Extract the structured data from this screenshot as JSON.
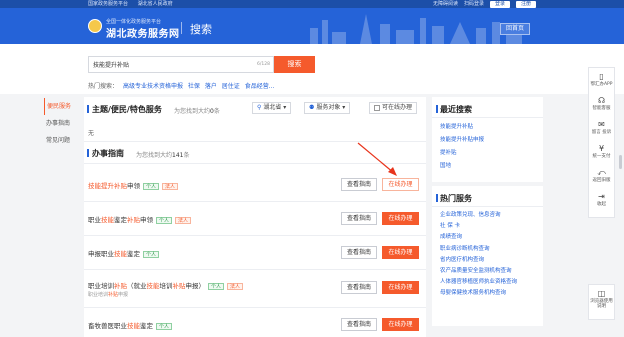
{
  "topbar": {
    "left": [
      "国家政务服务平台",
      "湖北省人民政府"
    ],
    "accessibility": "无障碍阅读",
    "scan": "扫码登录",
    "login": "登录",
    "register": "注册"
  },
  "header": {
    "logo_sub": "全国一体化政务服务平台",
    "logo_main": "湖北政务服务网",
    "page_title": "搜索",
    "home_button": "回首页"
  },
  "search": {
    "value": "技能提升补贴",
    "counter": "6/128",
    "button": "搜索",
    "hot_label": "热门搜索：",
    "hot_items": [
      "高级专业技术资格申报",
      "社保",
      "落户",
      "居住证",
      "食品经营..."
    ]
  },
  "left_nav": [
    "便民服务",
    "办事指南",
    "常见问题"
  ],
  "sections": {
    "themes": {
      "title": "主题/便民/特色服务",
      "count_prefix": "为您找到大约",
      "count": "0",
      "count_suffix": "条",
      "region": "湖北省",
      "target": "服务对象",
      "online_only": "可在线办理",
      "empty_text": "无"
    },
    "guides": {
      "title": "办事指南",
      "count_prefix": "为您找到大约",
      "count": "141",
      "count_suffix": "条"
    }
  },
  "results": [
    {
      "pre": "",
      "hl": "技能提升补贴",
      "post": "申领",
      "tags": [
        "个人",
        "法人"
      ],
      "sub_pre": "",
      "sub_hl": "",
      "view": "查看指南",
      "online": "在线办理"
    },
    {
      "pre": "职业",
      "hl": "技能",
      "mid": "鉴定",
      "hl2": "补贴",
      "post": "申领",
      "tags": [
        "个人",
        "法人"
      ],
      "view": "查看指南",
      "online": "在线办理"
    },
    {
      "pre": "申报职业",
      "hl": "技能",
      "post": "鉴定",
      "tags": [
        "个人"
      ],
      "view": "查看指南",
      "online": "在线办理"
    },
    {
      "pre": "职业培训",
      "hl": "补贴",
      "mid": "（就业",
      "hl2": "技能",
      "mid2": "培训",
      "hl3": "补贴",
      "post": "申报）",
      "tags": [
        "个人",
        "法人"
      ],
      "sub_pre": "职业培训",
      "sub_hl": "补贴",
      "sub_post": "申报",
      "view": "查看指南",
      "online": "在线办理"
    },
    {
      "pre": "畜牧兽医职业",
      "hl": "技能",
      "post": "鉴定",
      "tags": [
        "个人"
      ],
      "view": "查看指南",
      "online": "在线办理"
    }
  ],
  "recent": {
    "title": "最近搜索",
    "items": [
      "技能提升补贴",
      "技能提升补贴申报",
      "提补贴",
      "国地"
    ]
  },
  "hot_services": {
    "title": "热门服务",
    "items": [
      "企业政策兑现、信息咨询",
      "社 保 卡",
      "成绩查询",
      "职业病诊断机构查询",
      "省内医疗机构查询",
      "农产品质量安全监测机构查询",
      "人体器官移植医师执业资格查询",
      "母婴保健技术服务机构查询"
    ]
  },
  "float_toolbar": [
    {
      "icon": "phone-icon",
      "label": "鄂汇办APP",
      "glyph": "▯"
    },
    {
      "icon": "headset-icon",
      "label": "智能客服",
      "glyph": "☊"
    },
    {
      "icon": "mail-icon",
      "label": "留言 投诉",
      "glyph": "✉"
    },
    {
      "icon": "pay-icon",
      "label": "统一支付",
      "glyph": "¥"
    },
    {
      "icon": "return-icon",
      "label": "返回旧版",
      "glyph": "⤺"
    },
    {
      "icon": "collect-icon",
      "label": "收起",
      "glyph": "⇥"
    }
  ],
  "browser_tip": "浏览器使用说明",
  "colors": {
    "brand": "#2563d8",
    "accent": "#f55a2c",
    "tag_person": "#2e9a4b"
  }
}
